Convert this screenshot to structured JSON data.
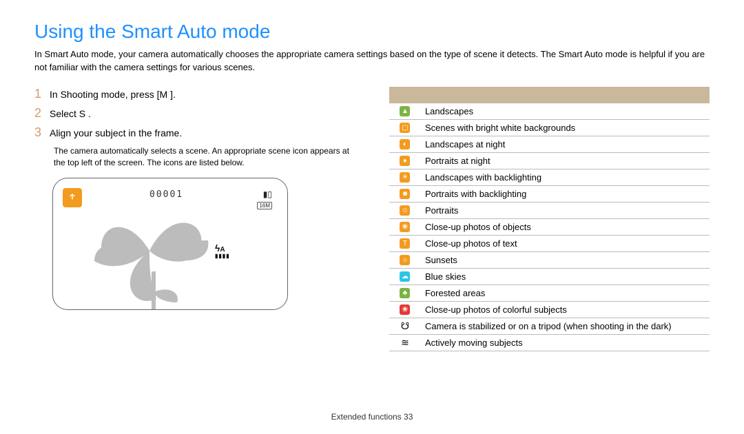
{
  "title": "Using the Smart Auto mode",
  "intro": "In Smart Auto mode, your camera automatically chooses the appropriate camera settings based on the type of scene it detects. The Smart Auto mode is helpful if you are not familiar with the camera settings for various scenes.",
  "steps": [
    {
      "num": "1",
      "text": "In Shooting mode, press [M      ]."
    },
    {
      "num": "2",
      "text": "Select S  ."
    },
    {
      "num": "3",
      "text": "Align your subject in the frame."
    }
  ],
  "step3_sub": "The camera automatically selects a scene. An appropriate scene icon appears at the top left of the screen. The icons are listed below.",
  "screen": {
    "scene_icon_name": "macro-icon",
    "counter": "00001",
    "size_badge": "16M"
  },
  "icon_table": [
    {
      "color": "bg-green",
      "label": "Landscapes",
      "glyph": "▲"
    },
    {
      "color": "bg-orange",
      "label": "Scenes with bright white backgrounds",
      "glyph": "▢"
    },
    {
      "color": "bg-orange",
      "label": "Landscapes at night",
      "glyph": "◐"
    },
    {
      "color": "bg-orange",
      "label": "Portraits at night",
      "glyph": "●"
    },
    {
      "color": "bg-orange",
      "label": "Landscapes with backlighting",
      "glyph": "☀"
    },
    {
      "color": "bg-orange",
      "label": "Portraits with backlighting",
      "glyph": "☻"
    },
    {
      "color": "bg-orange",
      "label": "Portraits",
      "glyph": "☺"
    },
    {
      "color": "bg-orange",
      "label": "Close-up photos of objects",
      "glyph": "❀"
    },
    {
      "color": "bg-orange",
      "label": "Close-up photos of text",
      "glyph": "T"
    },
    {
      "color": "bg-orange",
      "label": "Sunsets",
      "glyph": "☼"
    },
    {
      "color": "bg-cyan",
      "label": "Blue skies",
      "glyph": "☁"
    },
    {
      "color": "bg-green",
      "label": "Forested areas",
      "glyph": "♣"
    },
    {
      "color": "bg-red",
      "label": "Close-up photos of colorful subjects",
      "glyph": "❀"
    },
    {
      "color": "bg-none",
      "label": "Camera is stabilized or on a tripod (when shooting in the dark)",
      "glyph": "☋"
    },
    {
      "color": "bg-none",
      "label": "Actively moving subjects",
      "glyph": "≋"
    }
  ],
  "footer": {
    "section": "Extended functions",
    "page": "33"
  }
}
